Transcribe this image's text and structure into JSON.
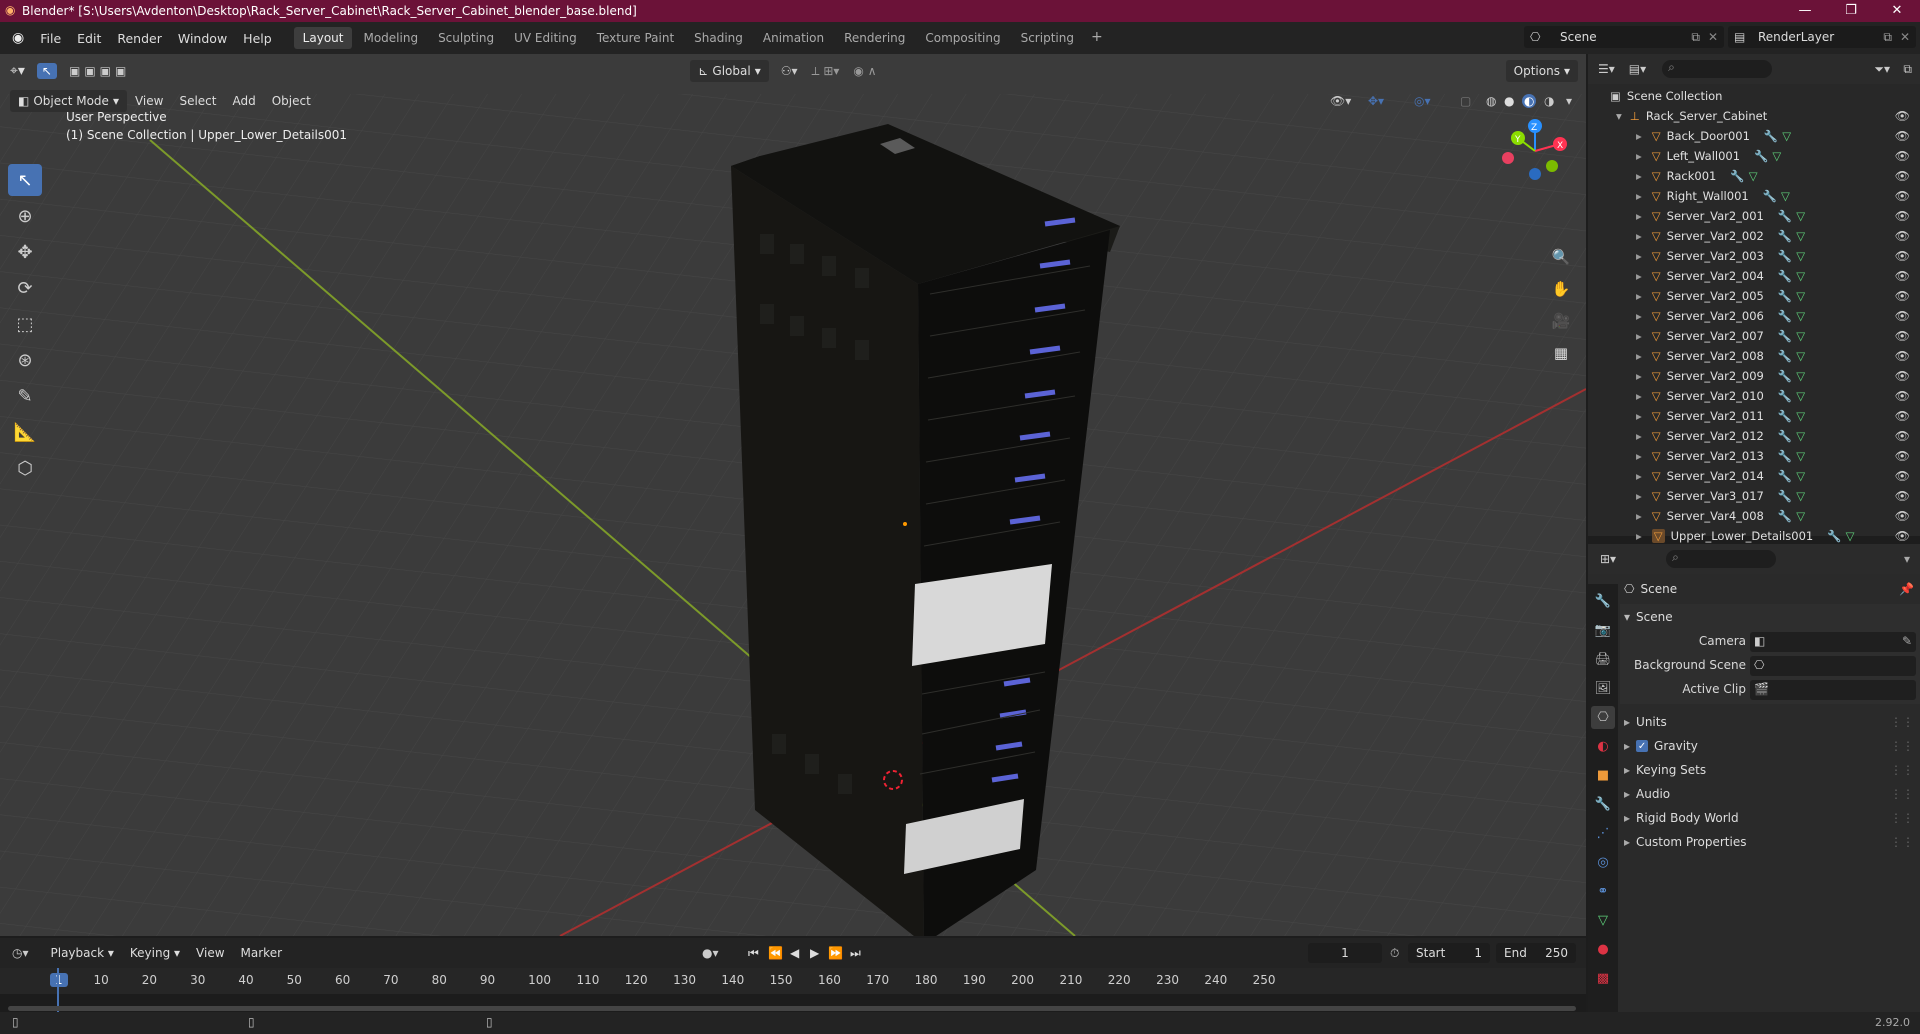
{
  "window": {
    "title": "Blender* [S:\\Users\\Avdenton\\Desktop\\Rack_Server_Cabinet\\Rack_Server_Cabinet_blender_base.blend]",
    "controls": [
      "—",
      "❐",
      "✕"
    ]
  },
  "menu": [
    "File",
    "Edit",
    "Render",
    "Window",
    "Help"
  ],
  "workspaces": [
    "Layout",
    "Modeling",
    "Sculpting",
    "UV Editing",
    "Texture Paint",
    "Shading",
    "Animation",
    "Rendering",
    "Compositing",
    "Scripting",
    "+"
  ],
  "active_workspace": "Layout",
  "scene": {
    "name": "Scene",
    "render_layer": "RenderLayer"
  },
  "viewport": {
    "mode": "Object Mode",
    "menus": [
      "View",
      "Select",
      "Add",
      "Object"
    ],
    "transform_orientation": "Global",
    "options_label": "Options",
    "perspective": "User Perspective",
    "context": "(1) Scene Collection | Upper_Lower_Details001",
    "gizmo": {
      "x": "X",
      "y": "Y",
      "z": "Z"
    }
  },
  "outliner": {
    "root": "Scene Collection",
    "collection": "Rack_Server_Cabinet",
    "objects": [
      "Back_Door001",
      "Left_Wall001",
      "Rack001",
      "Right_Wall001",
      "Server_Var2_001",
      "Server_Var2_002",
      "Server_Var2_003",
      "Server_Var2_004",
      "Server_Var2_005",
      "Server_Var2_006",
      "Server_Var2_007",
      "Server_Var2_008",
      "Server_Var2_009",
      "Server_Var2_010",
      "Server_Var2_011",
      "Server_Var2_012",
      "Server_Var2_013",
      "Server_Var2_014",
      "Server_Var3_017",
      "Server_Var4_008",
      "Upper_Lower_Details001"
    ]
  },
  "properties": {
    "context": "Scene",
    "panel_title": "Scene",
    "fields": [
      {
        "label": "Camera"
      },
      {
        "label": "Background Scene"
      },
      {
        "label": "Active Clip"
      }
    ],
    "sections": [
      "Units",
      "Gravity",
      "Keying Sets",
      "Audio",
      "Rigid Body World",
      "Custom Properties"
    ],
    "gravity_checked": true
  },
  "timeline": {
    "menus": [
      "Playback",
      "Keying",
      "View",
      "Marker"
    ],
    "current_frame": "1",
    "start_label": "Start",
    "start": "1",
    "end_label": "End",
    "end": "250",
    "ruler": [
      "1",
      "10",
      "20",
      "30",
      "40",
      "50",
      "60",
      "70",
      "80",
      "90",
      "100",
      "110",
      "120",
      "130",
      "140",
      "150",
      "160",
      "170",
      "180",
      "190",
      "200",
      "210",
      "220",
      "230",
      "240",
      "250"
    ]
  },
  "status": {
    "version": "2.92.0"
  },
  "colors": {
    "title_bar": "#6b1238",
    "accent": "#4772b3",
    "axis_x": "#ff3352",
    "axis_y": "#8bdc00",
    "axis_z": "#2890ff",
    "object_icon": "#ee9a3a"
  }
}
